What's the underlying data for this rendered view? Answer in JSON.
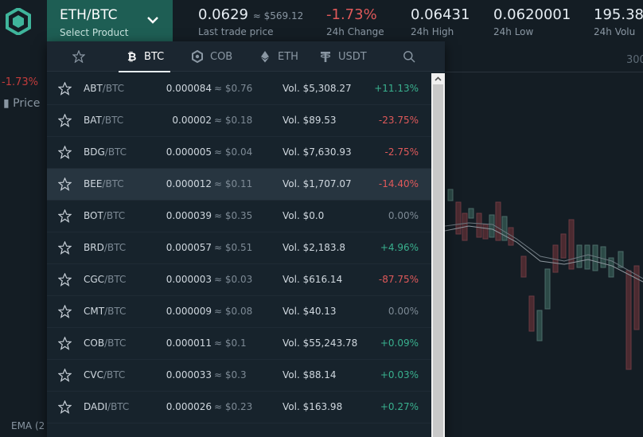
{
  "header": {
    "logo_icon": "cobinhood-logo-icon",
    "product": {
      "pair": "ETH/BTC",
      "sub": "Select Product"
    },
    "last_price": {
      "value": "0.0629",
      "usd": "≈ $569.12",
      "label": "Last trade price"
    },
    "change": {
      "value": "-1.73%",
      "label": "24h Change"
    },
    "high": {
      "value": "0.06431",
      "label": "24h High"
    },
    "low": {
      "value": "0.0620001",
      "label": "24h Low"
    },
    "volume": {
      "value": "195.38",
      "label": "24h Volu"
    }
  },
  "background": {
    "left_change": "-1.73%",
    "price_tab": "Price",
    "ema_label": "EMA (2",
    "right_axis": "300"
  },
  "dropdown": {
    "tabs": [
      {
        "label": "",
        "icon": "star-icon"
      },
      {
        "label": "BTC",
        "icon": "bitcoin-icon"
      },
      {
        "label": "COB",
        "icon": "cob-icon"
      },
      {
        "label": "ETH",
        "icon": "ethereum-icon"
      },
      {
        "label": "USDT",
        "icon": "tether-icon"
      },
      {
        "label": "",
        "icon": "search-icon"
      }
    ],
    "active_tab": "BTC",
    "rows": [
      {
        "base": "ABT",
        "quote": "/BTC",
        "price": "0.000084",
        "usd": "$0.76",
        "vol": "Vol. $5,308.27",
        "change": "+11.13%",
        "dir": "up"
      },
      {
        "base": "BAT",
        "quote": "/BTC",
        "price": "0.00002",
        "usd": "$0.18",
        "vol": "Vol. $89.53",
        "change": "-23.75%",
        "dir": "down"
      },
      {
        "base": "BDG",
        "quote": "/BTC",
        "price": "0.000005",
        "usd": "$0.04",
        "vol": "Vol. $7,630.93",
        "change": "-2.75%",
        "dir": "down"
      },
      {
        "base": "BEE",
        "quote": "/BTC",
        "price": "0.000012",
        "usd": "$0.11",
        "vol": "Vol. $1,707.07",
        "change": "-14.40%",
        "dir": "down"
      },
      {
        "base": "BOT",
        "quote": "/BTC",
        "price": "0.000039",
        "usd": "$0.35",
        "vol": "Vol. $0.0",
        "change": "0.00%",
        "dir": "flat"
      },
      {
        "base": "BRD",
        "quote": "/BTC",
        "price": "0.000057",
        "usd": "$0.51",
        "vol": "Vol. $2,183.8",
        "change": "+4.96%",
        "dir": "up"
      },
      {
        "base": "CGC",
        "quote": "/BTC",
        "price": "0.000003",
        "usd": "$0.03",
        "vol": "Vol. $616.14",
        "change": "-87.75%",
        "dir": "down"
      },
      {
        "base": "CMT",
        "quote": "/BTC",
        "price": "0.000009",
        "usd": "$0.08",
        "vol": "Vol. $40.13",
        "change": "0.00%",
        "dir": "flat"
      },
      {
        "base": "COB",
        "quote": "/BTC",
        "price": "0.000011",
        "usd": "$0.1",
        "vol": "Vol. $55,243.78",
        "change": "+0.09%",
        "dir": "up"
      },
      {
        "base": "CVC",
        "quote": "/BTC",
        "price": "0.000033",
        "usd": "$0.3",
        "vol": "Vol. $88.14",
        "change": "+0.03%",
        "dir": "up"
      },
      {
        "base": "DADI",
        "quote": "/BTC",
        "price": "0.000026",
        "usd": "$0.23",
        "vol": "Vol. $163.98",
        "change": "+0.27%",
        "dir": "up"
      }
    ],
    "highlighted_row": "BEE"
  },
  "colors": {
    "accent": "#1e5e54",
    "up": "#39b08e",
    "down": "#e0595a",
    "bg": "#141d24"
  }
}
